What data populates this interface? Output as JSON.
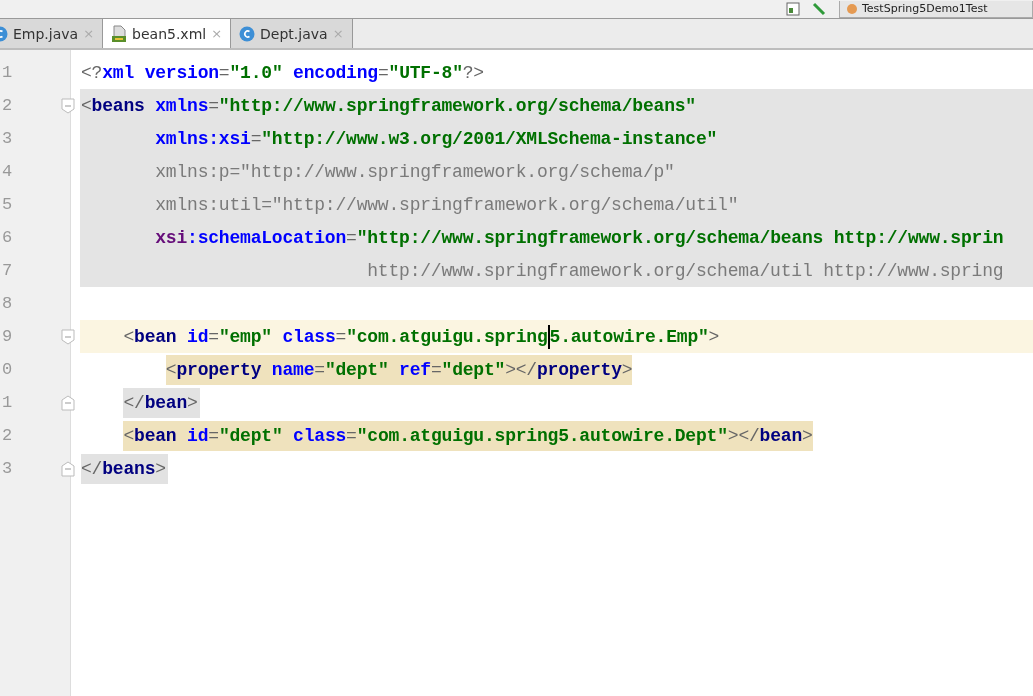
{
  "toolbar": {
    "run_config": "TestSpring5Demo1Test"
  },
  "tabs": [
    {
      "label": "Emp.java",
      "kind": "class",
      "close": "×",
      "selected": false
    },
    {
      "label": "bean5.xml",
      "kind": "xml",
      "close": "×",
      "selected": true
    },
    {
      "label": "Dept.java",
      "kind": "class",
      "close": "×",
      "selected": false
    }
  ],
  "editor": {
    "lines": [
      {
        "number": "1",
        "in_block": false,
        "current": false,
        "match": false,
        "brace": false,
        "fold_start": false,
        "fold_end": false,
        "tokens": [
          {
            "kind": "punct",
            "text": "<?"
          },
          {
            "kind": "attr",
            "text": "xml "
          },
          {
            "kind": "attr",
            "text": "version"
          },
          {
            "kind": "punct",
            "text": "="
          },
          {
            "kind": "value",
            "text": "\"1.0\" "
          },
          {
            "kind": "attr",
            "text": "encoding"
          },
          {
            "kind": "punct",
            "text": "="
          },
          {
            "kind": "value",
            "text": "\"UTF-8\""
          },
          {
            "kind": "punct",
            "text": "?>"
          }
        ]
      },
      {
        "number": "2",
        "in_block": true,
        "current": false,
        "match": false,
        "brace": false,
        "fold_start": true,
        "fold_end": false,
        "tokens": [
          {
            "kind": "punct",
            "text": "<"
          },
          {
            "kind": "tag",
            "text": "beans "
          },
          {
            "kind": "attr",
            "text": "xmlns"
          },
          {
            "kind": "punct",
            "text": "="
          },
          {
            "kind": "value",
            "text": "\"http://www.springframework.org/schema/beans\""
          }
        ]
      },
      {
        "number": "3",
        "in_block": true,
        "current": false,
        "match": false,
        "brace": false,
        "fold_start": false,
        "fold_end": false,
        "tokens": [
          {
            "kind": "attr",
            "text": "       xmlns:xsi"
          },
          {
            "kind": "punct",
            "text": "="
          },
          {
            "kind": "value",
            "text": "\"http://www.w3.org/2001/XMLSchema-instance\""
          }
        ]
      },
      {
        "number": "4",
        "in_block": true,
        "current": false,
        "match": false,
        "brace": false,
        "fold_start": false,
        "fold_end": false,
        "tokens": [
          {
            "kind": "unused",
            "text": "       xmlns:p=\"http://www.springframework.org/schema/p\""
          }
        ]
      },
      {
        "number": "5",
        "in_block": true,
        "current": false,
        "match": false,
        "brace": false,
        "fold_start": false,
        "fold_end": false,
        "tokens": [
          {
            "kind": "unused",
            "text": "       xmlns:util=\"http://www.springframework.org/schema/util\""
          }
        ]
      },
      {
        "number": "6",
        "in_block": true,
        "current": false,
        "match": false,
        "brace": false,
        "fold_start": false,
        "fold_end": false,
        "tokens": [
          {
            "kind": "ns",
            "text": "       xsi"
          },
          {
            "kind": "attr",
            "text": ":schemaLocation"
          },
          {
            "kind": "punct",
            "text": "="
          },
          {
            "kind": "value",
            "text": "\"http://www.springframework.org/schema/beans http://www.sprin"
          }
        ]
      },
      {
        "number": "7",
        "in_block": true,
        "current": false,
        "match": false,
        "brace": false,
        "fold_start": false,
        "fold_end": false,
        "tokens": [
          {
            "kind": "unused",
            "text": "                           http://www.springframework.org/schema/util http://www.spring"
          }
        ]
      },
      {
        "number": "8",
        "in_block": false,
        "current": false,
        "fold_start": false,
        "fold_end": false
      },
      {
        "number": "9",
        "in_block": false,
        "current": true,
        "match": false,
        "brace": false,
        "fold_start": true,
        "fold_end": false,
        "tokens": [
          {
            "kind": "punct",
            "text": "    <"
          },
          {
            "kind": "tag",
            "text": "bean "
          },
          {
            "kind": "attr",
            "text": "id"
          },
          {
            "kind": "punct",
            "text": "="
          },
          {
            "kind": "value",
            "text": "\"emp\" "
          },
          {
            "kind": "attr",
            "text": "class"
          },
          {
            "kind": "punct",
            "text": "="
          },
          {
            "kind": "value",
            "text": "\"com.atguigu.spring",
            "caret": false
          },
          {
            "kind": "value",
            "text": "5.autowire.Emp\"",
            "caret": true
          },
          {
            "kind": "punct",
            "text": ">"
          }
        ]
      },
      {
        "number": "0",
        "in_block": false,
        "current": false,
        "match": true,
        "brace": false,
        "fold_start": false,
        "fold_end": false,
        "tokens": [
          {
            "kind": "punct",
            "text": "        <"
          },
          {
            "kind": "tag",
            "text": "property "
          },
          {
            "kind": "attr",
            "text": "name"
          },
          {
            "kind": "punct",
            "text": "="
          },
          {
            "kind": "value",
            "text": "\"dept\" "
          },
          {
            "kind": "attr",
            "text": "ref"
          },
          {
            "kind": "punct",
            "text": "="
          },
          {
            "kind": "value",
            "text": "\"dept\""
          },
          {
            "kind": "punct",
            "text": "></"
          },
          {
            "kind": "tag",
            "text": "property"
          },
          {
            "kind": "punct",
            "text": ">"
          }
        ]
      },
      {
        "number": "1",
        "in_block": false,
        "current": false,
        "match": false,
        "brace": true,
        "fold_start": false,
        "fold_end": true,
        "tokens": [
          {
            "kind": "punct",
            "text": "    </"
          },
          {
            "kind": "tag",
            "text": "bean"
          },
          {
            "kind": "punct",
            "text": ">"
          }
        ]
      },
      {
        "number": "2",
        "in_block": false,
        "current": false,
        "match": true,
        "brace": false,
        "fold_start": false,
        "fold_end": false,
        "tokens": [
          {
            "kind": "punct",
            "text": "    <"
          },
          {
            "kind": "tag",
            "text": "bean "
          },
          {
            "kind": "attr",
            "text": "id"
          },
          {
            "kind": "punct",
            "text": "="
          },
          {
            "kind": "value",
            "text": "\"dept\" "
          },
          {
            "kind": "attr",
            "text": "class"
          },
          {
            "kind": "punct",
            "text": "="
          },
          {
            "kind": "value",
            "text": "\"com.atguigu.spring5.autowire.Dept\""
          },
          {
            "kind": "punct",
            "text": "></"
          },
          {
            "kind": "tag",
            "text": "bean"
          },
          {
            "kind": "punct",
            "text": ">"
          }
        ]
      },
      {
        "number": "3",
        "in_block": false,
        "current": false,
        "match": false,
        "brace": true,
        "fold_start": false,
        "fold_end": true,
        "tokens": [
          {
            "kind": "punct",
            "text": "</"
          },
          {
            "kind": "tag",
            "text": "beans"
          },
          {
            "kind": "punct",
            "text": ">"
          }
        ]
      }
    ]
  }
}
